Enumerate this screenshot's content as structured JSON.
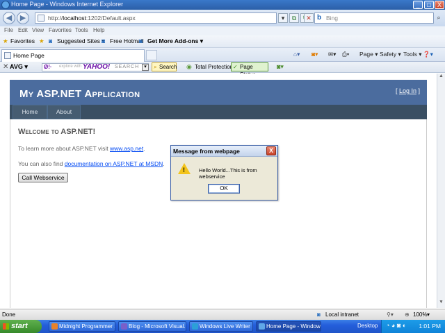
{
  "window": {
    "title": "Home Page - Windows Internet Explorer",
    "controls": [
      "_",
      "□",
      "X"
    ]
  },
  "address_bar": {
    "url_prefix": "http://",
    "url_host": "localhost",
    "url_rest": ":1202/Default.aspx",
    "search_placeholder": "Bing",
    "search_engine_letter": "b"
  },
  "menu": [
    "File",
    "Edit",
    "View",
    "Favorites",
    "Tools",
    "Help"
  ],
  "favorites_bar": {
    "favorites": "Favorites",
    "suggested": "Suggested Sites ▾",
    "hotmail": "Free Hotmail",
    "addons": "Get More Add-ons ▾"
  },
  "tabs": {
    "active_tab": "Home Page",
    "commands": [
      "Page ▾",
      "Safety ▾",
      "Tools ▾",
      "❓▾"
    ]
  },
  "avg_toolbar": {
    "close": "✕",
    "avg": "AVG ▾",
    "yahoo_prefix": "explore with",
    "yahoo": "YAHOO!",
    "search_word": "SEARCH",
    "search_button": "Search",
    "total_protection": "Total Protection",
    "page_status": "Page Status"
  },
  "page": {
    "app_title": "My ASP.NET Application",
    "login_open": "[ ",
    "login_link": "Log In",
    "login_close": " ]",
    "nav": [
      "Home",
      "About"
    ],
    "welcome": "Welcome to ASP.NET!",
    "p1_text": "To learn more about ASP.NET visit ",
    "p1_link": "www.asp.net",
    "p1_end": ".",
    "p2_text": "You can also find ",
    "p2_link": "documentation on ASP.NET at MSDN",
    "p2_end": ".",
    "call_button": "Call Webservice"
  },
  "dialog": {
    "title": "Message from webpage",
    "message": "Hello World...This is from webservice",
    "ok": "OK",
    "close": "X"
  },
  "status_bar": {
    "left": "Done",
    "zone": "Local intranet",
    "zoom": "100%"
  },
  "taskbar": {
    "start": "start",
    "tasks": [
      {
        "label": "Midnight Programmer ...",
        "color": "#e8822a"
      },
      {
        "label": "Blog - Microsoft Visual...",
        "color": "#7a5fc9"
      },
      {
        "label": "Windows Live Writer",
        "color": "#2c9fd8"
      },
      {
        "label": "Home Page - Window...",
        "color": "#5fa7e8"
      }
    ],
    "desktop": "Desktop",
    "time": "1:01 PM"
  }
}
